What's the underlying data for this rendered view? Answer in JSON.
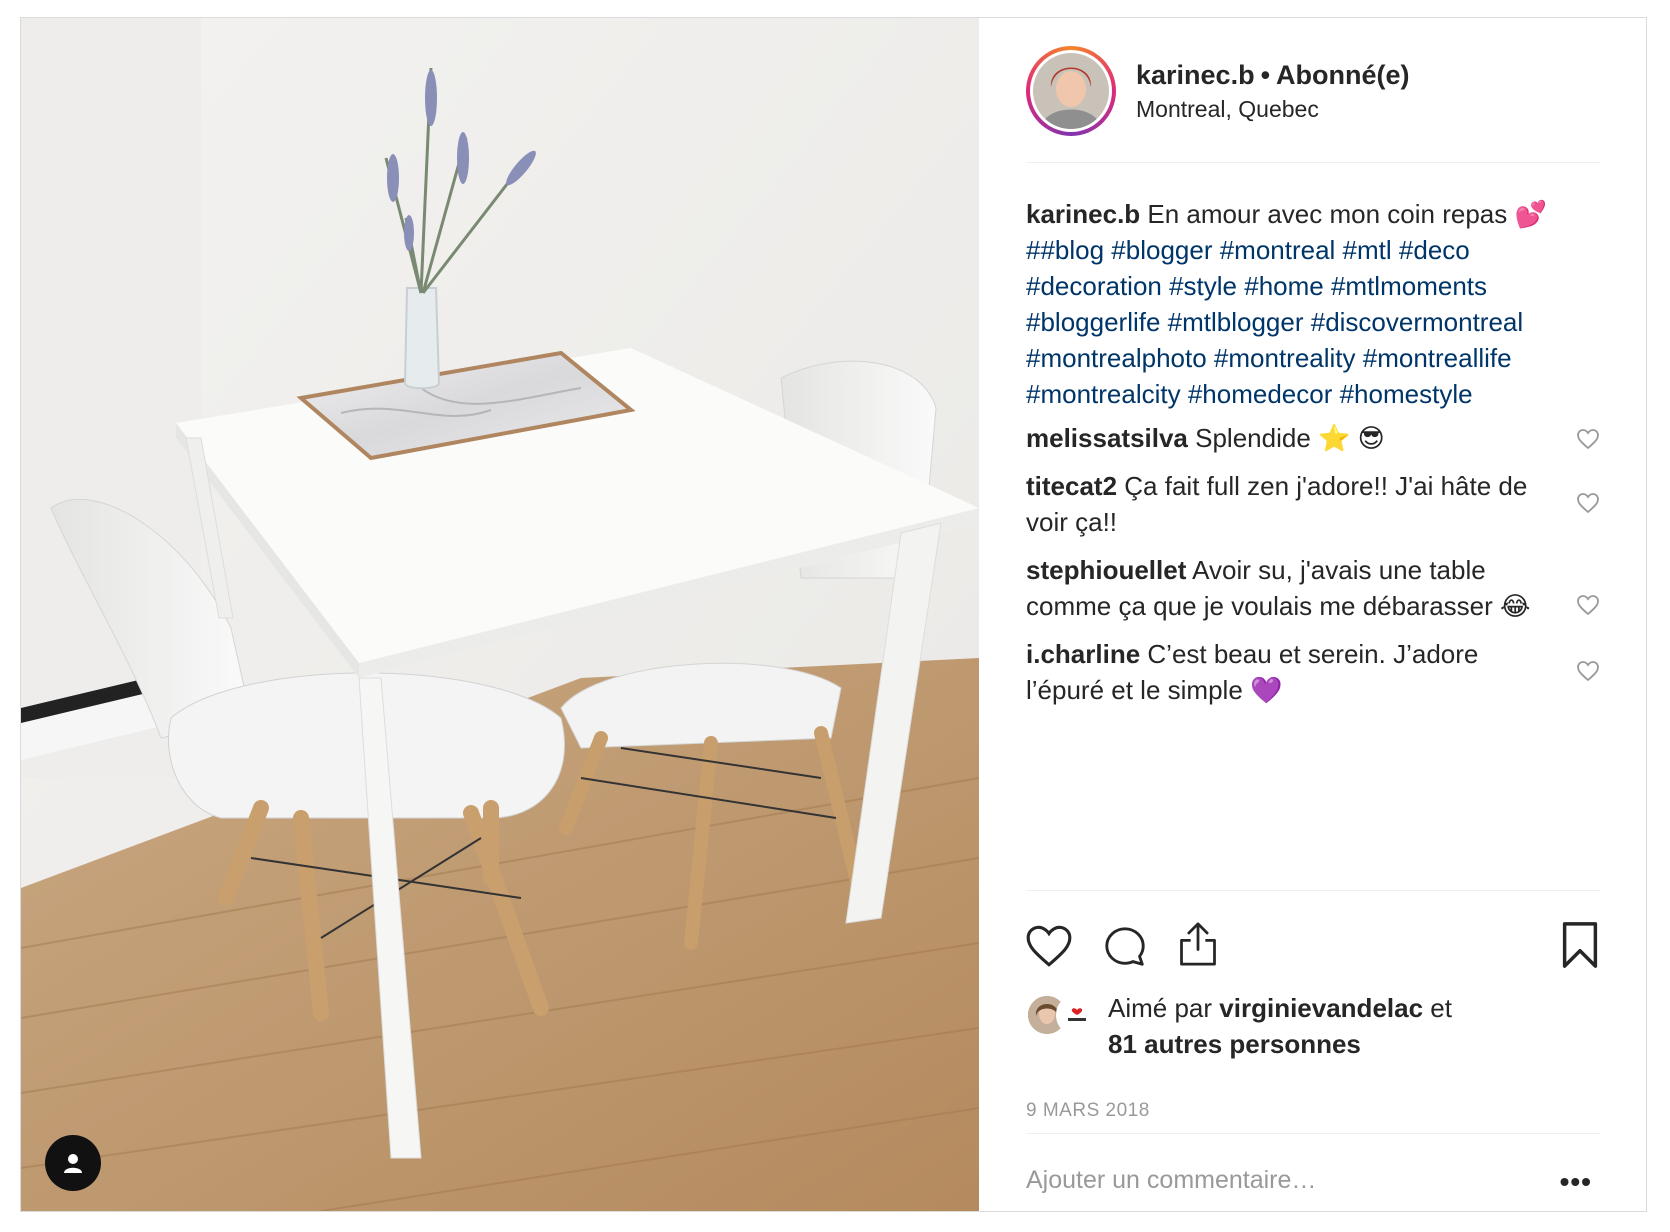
{
  "post": {
    "username": "karinec.b",
    "separator": "•",
    "follow_status": "Abonné(e)",
    "location": "Montreal, Quebec"
  },
  "caption": {
    "username": "karinec.b",
    "text": "En amour avec mon coin repas 💕",
    "hashtags": "##blog #blogger #montreal #mtl #deco #decoration #style #home #mtlmoments #bloggerlife #mtlblogger #discovermontreal #montrealphoto #montreality #montreallife #montrealcity #homedecor #homestyle"
  },
  "comments": [
    {
      "user": "melissatsilva",
      "text": "Splendide ⭐️  😎"
    },
    {
      "user": "titecat2",
      "text": "Ça fait full zen j'adore!! J'ai hâte de voir ça!!"
    },
    {
      "user": "stephiouellet",
      "text": "Avoir su, j'avais une table comme ça que je voulais me débarasser 😂"
    },
    {
      "user": "i.charline",
      "text": "C’est beau et serein. J’adore l’épuré et le simple 💜"
    }
  ],
  "likes": {
    "prefix": "Aimé par",
    "user": "virginievandelac",
    "conj": "et",
    "others": "81 autres personnes"
  },
  "date": "9 MARS 2018",
  "add_comment_placeholder": "Ajouter un commentaire…",
  "more_label": "•••",
  "icons": {
    "like": "heart-icon",
    "comment": "comment-icon",
    "share": "share-icon",
    "save": "bookmark-icon",
    "tag": "user-tag-icon"
  },
  "colors": {
    "hashtag": "#003569",
    "text": "#262626",
    "muted": "#999999",
    "border": "#dbdbdb"
  }
}
